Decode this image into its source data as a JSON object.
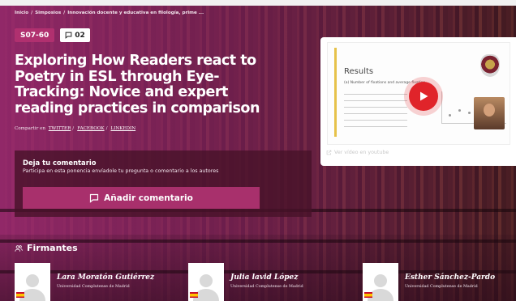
{
  "breadcrumb": {
    "items": [
      "Inicio",
      "Simposios",
      "Innovación docente y educativa en filología, prime ..."
    ],
    "separator": "/"
  },
  "badges": {
    "code": "S07-60",
    "comments_count": "02"
  },
  "title": "Exploring How Readers react to Poetry in ESL through Eye-Tracking: Novice and expert reading practices in comparison",
  "share": {
    "label": "Compartir en",
    "links": [
      "TWITTER",
      "FACEBOOK",
      "LINKEDIN"
    ],
    "separator": "/"
  },
  "comment": {
    "title": "Deja tu comentario",
    "description": "Participa en esta ponencia envíadole tu pregunta o comentario a los autores",
    "button_label": "Añadir comentario"
  },
  "video": {
    "slide_title": "Results",
    "slide_subtitle": "(a) Number of fixations and average fixation...",
    "youtube_link": "Ver vídeo en youtube"
  },
  "signers": {
    "heading": "Firmantes",
    "authors": [
      {
        "name": "Lara Moratón Gutiérrez",
        "affiliation": "Universidad Complutense de Madrid"
      },
      {
        "name": "Julia lavid López",
        "affiliation": "Universidad Complutense de Madrid"
      },
      {
        "name": "Esther Sánchez-Pardo",
        "affiliation": "Universidad Complutense de Madrid"
      }
    ]
  },
  "colors": {
    "accent": "#b0306f",
    "button": "#a8306c",
    "play": "#e0242a"
  },
  "icons": {
    "comment": "speech-bubble-icon",
    "play": "play-icon",
    "external": "external-link-icon",
    "users": "users-icon",
    "flag": "spain-flag-icon"
  }
}
